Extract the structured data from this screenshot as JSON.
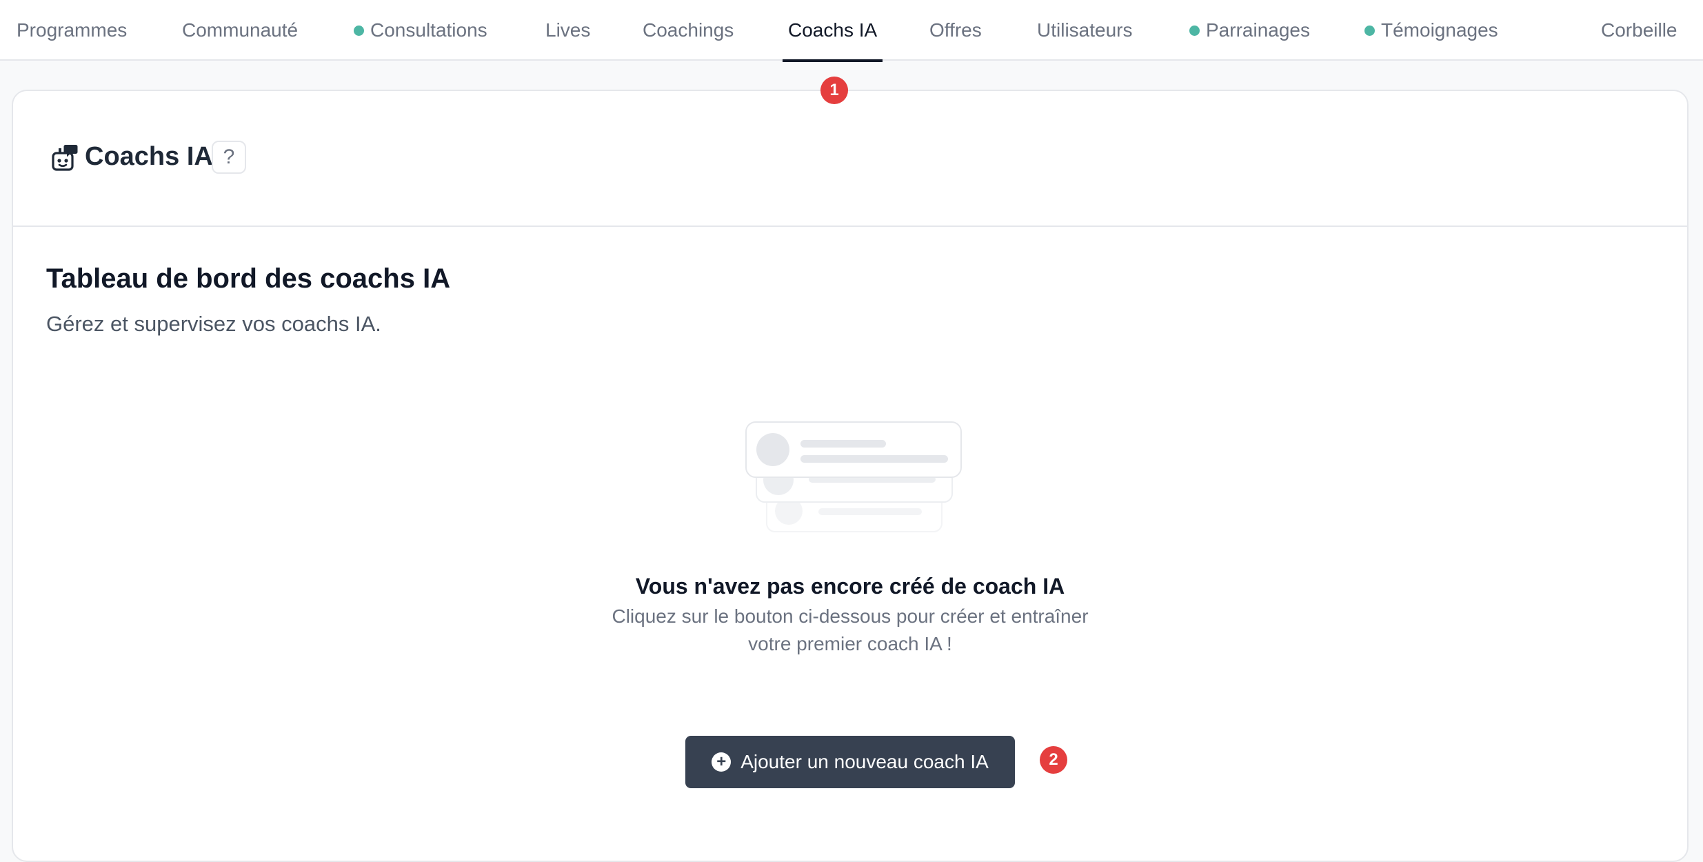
{
  "nav": {
    "tabs": [
      {
        "label": "Programmes"
      },
      {
        "label": "Communauté"
      },
      {
        "label": "Consultations"
      },
      {
        "label": "Lives"
      },
      {
        "label": "Coachings"
      },
      {
        "label": "Coachs IA"
      },
      {
        "label": "Offres"
      },
      {
        "label": "Utilisateurs"
      },
      {
        "label": "Parrainages"
      },
      {
        "label": "Témoignages"
      },
      {
        "label": "Corbeille"
      }
    ],
    "active": "Coachs IA",
    "dot_color": "#4db6a4"
  },
  "badges": [
    "1",
    "2"
  ],
  "header": {
    "title": "Coachs IA",
    "help": "?",
    "icon": "robot-chat-icon"
  },
  "dashboard": {
    "title": "Tableau de bord des coachs IA",
    "subtitle": "Gérez et supervisez vos coachs IA."
  },
  "empty_state": {
    "title": "Vous n'avez pas encore créé de coach IA",
    "desc_line1": "Cliquez sur le bouton ci-dessous pour créer et entraîner",
    "desc_line2": "votre premier coach IA !"
  },
  "add_button": {
    "label": "Ajouter un nouveau coach IA",
    "icon": "plus-circle-icon"
  },
  "colors": {
    "button_bg": "#374151",
    "badge": "#e53e3e",
    "active_underline": "#111827"
  }
}
